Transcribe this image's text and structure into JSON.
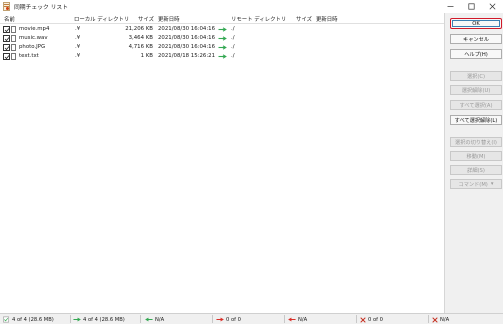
{
  "window": {
    "title": "同期チェック リスト",
    "min_label": "—",
    "max_label": "☐",
    "close_label": "✕"
  },
  "columns": {
    "name": "名前",
    "local_dir": "ローカル ディレクトリ",
    "size": "サイズ",
    "modified": "更新日時",
    "remote_dir": "リモート ディレクトリ",
    "remote_size": "サイズ",
    "remote_modified": "更新日時"
  },
  "rows": [
    {
      "checked": true,
      "name": "movie.mp4",
      "local_dir": ".¥",
      "size": "21,206 KB",
      "modified": "2021/08/30 16:04:16",
      "remote_dir": "./"
    },
    {
      "checked": true,
      "name": "music.wav",
      "local_dir": ".¥",
      "size": "3,464 KB",
      "modified": "2021/08/30 16:04:16",
      "remote_dir": "./"
    },
    {
      "checked": true,
      "name": "photo.JPG",
      "local_dir": ".¥",
      "size": "4,716 KB",
      "modified": "2021/08/30 16:04:16",
      "remote_dir": "./"
    },
    {
      "checked": true,
      "name": "text.txt",
      "local_dir": ".¥",
      "size": "1 KB",
      "modified": "2021/08/18 15:26:21",
      "remote_dir": "./"
    }
  ],
  "buttons": {
    "ok": "OK",
    "cancel": "キャンセル",
    "help": "ヘルプ(H)",
    "select": "選択(C)",
    "deselect": "選択解除(U)",
    "select_all": "すべて選択(A)",
    "deselect_all": "すべて選択解除(L)",
    "toggle_selection": "選択の切り替え(I)",
    "move": "移動(M)",
    "details": "詳細(S)",
    "command": "コマンド(M)"
  },
  "status": {
    "all": "4 of 4 (28.6 MB)",
    "upload": "4 of 4 (28.6 MB)",
    "download": "N/A",
    "delete_local": "0 of 0",
    "delete_remote": "N/A",
    "conflict_local": "0 of 0",
    "conflict_remote": "N/A"
  },
  "colors": {
    "accent_red": "#d11a2a",
    "arrow_green": "#34a853",
    "arrow_red": "#d9302a",
    "delete_red": "#c42b1c"
  }
}
